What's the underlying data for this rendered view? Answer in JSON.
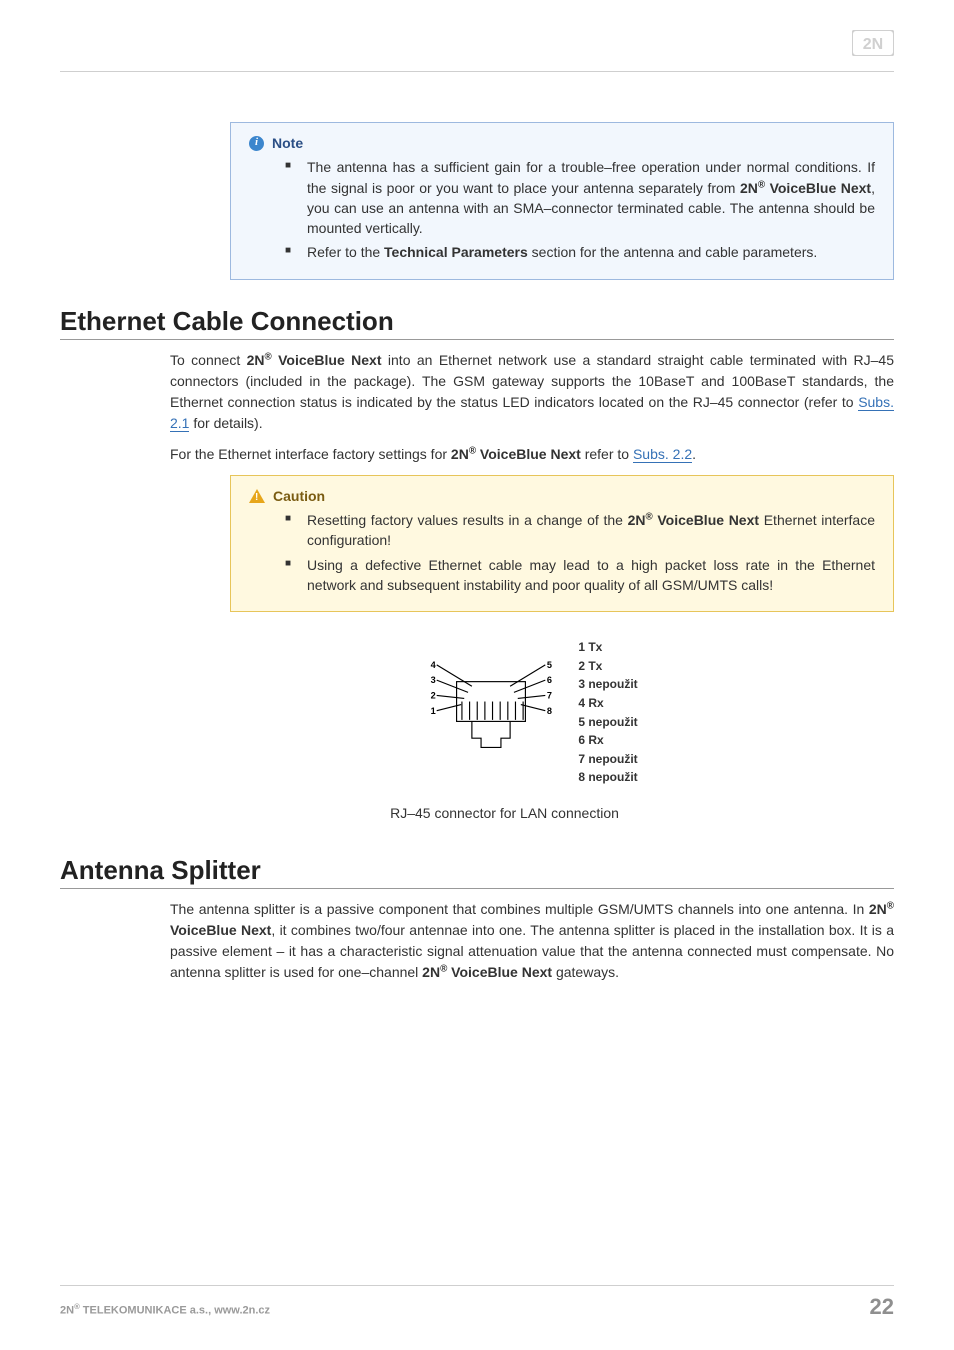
{
  "brand": {
    "logo_text": "2N"
  },
  "note": {
    "title": "Note",
    "items": [
      {
        "pre": " The antenna has a sufficient gain for a trouble–free operation under normal conditions. If the signal is poor or you want to place your antenna separately from ",
        "prod_pre": "2N",
        "prod_sup": "®",
        "prod_post": " VoiceBlue Next",
        "post": ", you can use an antenna with an SMA–connector terminated cable. The antenna should be mounted vertically."
      },
      {
        "pre": "Refer to the ",
        "bold": "Technical Parameters",
        "post": " section for the antenna and cable parameters."
      }
    ]
  },
  "section1": {
    "title": "Ethernet Cable Connection",
    "para1": {
      "pre": "To connect ",
      "prod_pre": "2N",
      "prod_sup": "®",
      "prod_post": " VoiceBlue Next",
      "mid": " into an Ethernet network use a standard straight cable terminated with RJ–45 connectors (included in the package). The GSM gateway supports the 10BaseT and 100BaseT standards, the Ethernet connection status is indicated by the status LED indicators located on the RJ–45 connector (refer to ",
      "link": "Subs. 2.1",
      "post": " for details)."
    },
    "para2": {
      "pre": "For the Ethernet interface factory settings for ",
      "prod_pre": "2N",
      "prod_sup": "®",
      "prod_post": " VoiceBlue Next",
      "mid": " refer to ",
      "link": "Subs. 2.2",
      "post": "."
    }
  },
  "caution": {
    "title": "Caution",
    "items": [
      {
        "pre": "Resetting factory values results in a change of the ",
        "prod_pre": "2N",
        "prod_sup": "®",
        "prod_post": " VoiceBlue Next",
        "post": " Ethernet interface configuration!"
      },
      {
        "text": "Using a defective Ethernet cable may lead to a high packet loss rate in the Ethernet network and subsequent instability and poor quality of all GSM/UMTS calls!"
      }
    ]
  },
  "chart_data": {
    "type": "table",
    "title": "RJ–45 connector for LAN connection",
    "left_pins": [
      "4",
      "3",
      "2",
      "1"
    ],
    "right_pins": [
      "5",
      "6",
      "7",
      "8"
    ],
    "legend": [
      {
        "pin": "1",
        "label": "Tx"
      },
      {
        "pin": "2",
        "label": "Tx"
      },
      {
        "pin": "3",
        "label": "nepoužit"
      },
      {
        "pin": "4",
        "label": "Rx"
      },
      {
        "pin": "5",
        "label": "nepoužit"
      },
      {
        "pin": "6",
        "label": "Rx"
      },
      {
        "pin": "7",
        "label": "nepoužit"
      },
      {
        "pin": "8",
        "label": "nepoužit"
      }
    ]
  },
  "caption": "RJ–45 connector for LAN connection",
  "section2": {
    "title": "Antenna Splitter",
    "para": {
      "pre": "The antenna splitter is a passive component that combines multiple GSM/UMTS channels into one antenna. In ",
      "prod_pre": "2N",
      "prod_sup": "®",
      "prod_post": " VoiceBlue Next",
      "mid": ", it combines two/four antennae into one. The antenna splitter is placed in the installation box. It is a passive element – it has a characteristic signal attenuation value that the antenna connected must compensate. No antenna splitter is used for one–channel ",
      "prod2_pre": "2N",
      "prod2_sup": "®",
      "prod2_post": " VoiceBlue Next",
      "post": " gateways."
    }
  },
  "footer": {
    "company_pre": "2N",
    "company_sup": "®",
    "company_post": " TELEKOMUNIKACE a.s., www.2n.cz",
    "page": "22"
  }
}
